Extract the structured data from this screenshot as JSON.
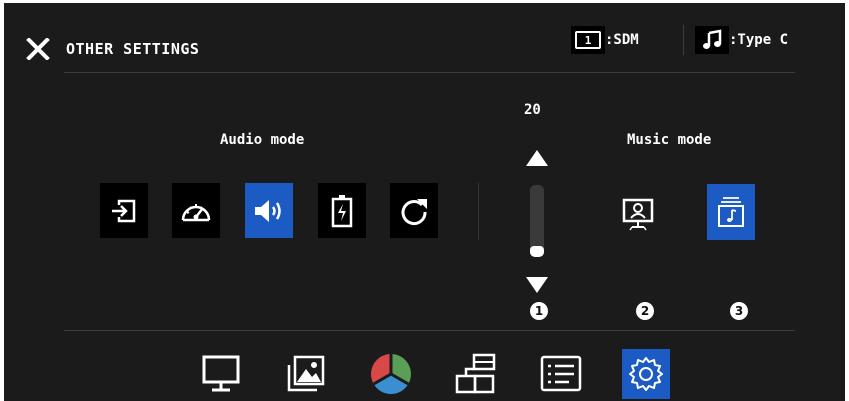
{
  "header": {
    "title": "OTHER SETTINGS",
    "input_box": "1",
    "input_value": ":SDM",
    "audio_value": ":Type C"
  },
  "audio_mode": {
    "label": "Audio mode",
    "icons": [
      "input-icon",
      "speedometer-icon",
      "speaker-icon",
      "battery-icon",
      "reset-icon"
    ],
    "selected": "speaker-icon"
  },
  "volume": {
    "value": "20",
    "level": 0.15
  },
  "music_mode": {
    "label": "Music mode",
    "icons": [
      "monitor-user-icon",
      "music-library-icon"
    ],
    "selected": "music-library-icon"
  },
  "badges": [
    "1",
    "2",
    "3"
  ],
  "bottom_nav": {
    "items": [
      "display-icon",
      "picture-icon",
      "color-icon",
      "layout-icon",
      "list-icon",
      "settings-icon"
    ],
    "selected": "settings-icon"
  },
  "colors": {
    "background": "#1b1b1b",
    "accent": "#1d5bc4",
    "text": "#ffffff"
  }
}
